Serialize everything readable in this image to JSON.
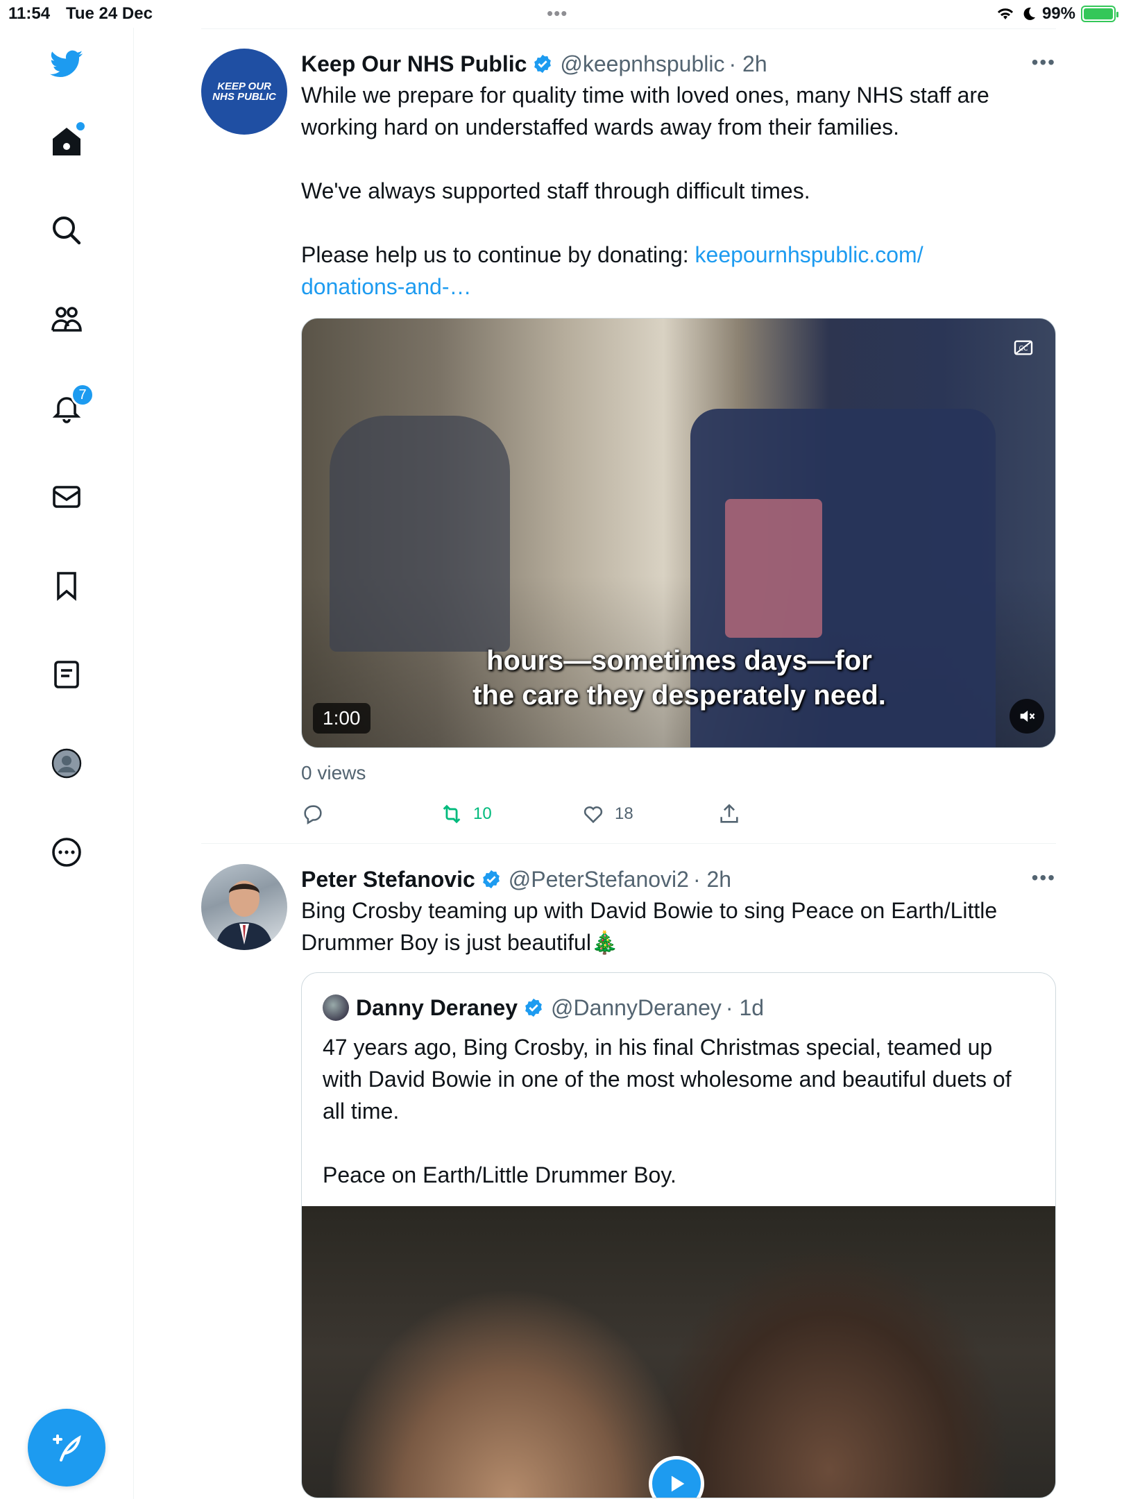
{
  "status_bar": {
    "time": "11:54",
    "date": "Tue 24 Dec",
    "battery_percent": "99%"
  },
  "sidebar": {
    "notifications_badge": "7",
    "items": [
      {
        "icon": "twitter-logo-icon"
      },
      {
        "icon": "home-icon"
      },
      {
        "icon": "search-icon"
      },
      {
        "icon": "communities-icon"
      },
      {
        "icon": "bell-icon"
      },
      {
        "icon": "mail-icon"
      },
      {
        "icon": "bookmark-icon"
      },
      {
        "icon": "lists-icon"
      },
      {
        "icon": "profile-icon"
      },
      {
        "icon": "more-icon"
      }
    ],
    "compose_icon": "feather-plus-icon"
  },
  "tweets": [
    {
      "avatar_text_line1": "KEEP OUR",
      "avatar_text_line2": "NHS PUBLIC",
      "name": "Keep Our NHS Public",
      "handle": "@keepnhspublic",
      "time": "· 2h",
      "text": "While we prepare for quality time with loved ones, many NHS staff are working hard on understaffed wards away from their families.\n\nWe've always supported staff through difficult times.\n\nPlease help us to continue by donating: ",
      "link": "keepournhspublic.com/\ndonations-and-…",
      "video": {
        "caption_line1": "hours—sometimes days—for",
        "caption_line2": "the care they desperately need.",
        "duration": "1:00"
      },
      "views": "0 views",
      "retweets": "10",
      "likes": "18"
    },
    {
      "name": "Peter Stefanovic",
      "handle": "@PeterStefanovi2",
      "time": "· 2h",
      "text": "Bing Crosby teaming up with David Bowie to sing Peace on Earth/Little Drummer Boy is just beautiful🎄",
      "quote": {
        "name": "Danny Deraney",
        "handle": "@DannyDeraney",
        "time": "· 1d",
        "text": "47 years ago, Bing Crosby, in his final Christmas special, teamed up with David Bowie in one of the most wholesome and beautiful duets of all time.\n\nPeace on Earth/Little Drummer Boy."
      }
    }
  ],
  "colors": {
    "accent": "#1d9bf0",
    "retweet_green": "#00ba7c",
    "secondary_text": "#536471"
  }
}
